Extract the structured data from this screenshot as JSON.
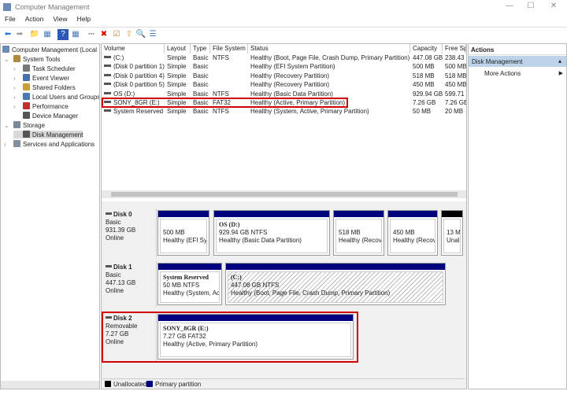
{
  "window": {
    "title": "Computer Management",
    "min": "—",
    "max": "☐",
    "close": "✕"
  },
  "menu": [
    "File",
    "Action",
    "View",
    "Help"
  ],
  "toolbar": {
    "icons": [
      "back-icon",
      "forward-icon",
      "up-folder-icon",
      "show-hide-tree-icon",
      "help-icon",
      "properties-view-icon",
      "connect-icon",
      "delete-icon",
      "check-icon",
      "folder-up-icon",
      "folder-search-icon",
      "list-view-icon"
    ]
  },
  "tree": [
    {
      "label": "Computer Management (Local",
      "indent": 0,
      "tw": "",
      "color": "#6a8bb5"
    },
    {
      "label": "System Tools",
      "indent": 1,
      "tw": "⌄",
      "color": "#b08a3c"
    },
    {
      "label": "Task Scheduler",
      "indent": 2,
      "tw": "›",
      "color": "#777"
    },
    {
      "label": "Event Viewer",
      "indent": 2,
      "tw": "›",
      "color": "#4a6fb0"
    },
    {
      "label": "Shared Folders",
      "indent": 2,
      "tw": "›",
      "color": "#c8a030"
    },
    {
      "label": "Local Users and Groups",
      "indent": 2,
      "tw": "›",
      "color": "#4a7ab5"
    },
    {
      "label": "Performance",
      "indent": 2,
      "tw": "›",
      "color": "#c03030"
    },
    {
      "label": "Device Manager",
      "indent": 2,
      "tw": "",
      "color": "#555"
    },
    {
      "label": "Storage",
      "indent": 1,
      "tw": "⌄",
      "color": "#7a8a9a"
    },
    {
      "label": "Disk Management",
      "indent": 2,
      "tw": "",
      "color": "#555",
      "selected": true
    },
    {
      "label": "Services and Applications",
      "indent": 1,
      "tw": "›",
      "color": "#8090a0"
    }
  ],
  "volume_list": {
    "columns": [
      "Volume",
      "Layout",
      "Type",
      "File System",
      "Status",
      "Capacity",
      "Free Sp"
    ],
    "rows": [
      [
        "(C:)",
        "Simple",
        "Basic",
        "NTFS",
        "Healthy (Boot, Page File, Crash Dump, Primary Partition)",
        "447.08 GB",
        "238.43"
      ],
      [
        "(Disk 0 partition 1)",
        "Simple",
        "Basic",
        "",
        "Healthy (EFI System Partition)",
        "500 MB",
        "500 MB"
      ],
      [
        "(Disk 0 partition 4)",
        "Simple",
        "Basic",
        "",
        "Healthy (Recovery Partition)",
        "518 MB",
        "518 MB"
      ],
      [
        "(Disk 0 partition 5)",
        "Simple",
        "Basic",
        "",
        "Healthy (Recovery Partition)",
        "450 MB",
        "450 MB"
      ],
      [
        "OS (D:)",
        "Simple",
        "Basic",
        "NTFS",
        "Healthy (Basic Data Partition)",
        "929.94 GB",
        "599.71"
      ],
      [
        "SONY_8GR (E:)",
        "Simple",
        "Basic",
        "FAT32",
        "Healthy (Active, Primary Partition)",
        "7.26 GB",
        "7.26 GB"
      ],
      [
        "System Reserved",
        "Simple",
        "Basic",
        "NTFS",
        "Healthy (System, Active, Primary Partition)",
        "50 MB",
        "20 MB"
      ]
    ],
    "highlighted_row": 5
  },
  "disks": [
    {
      "name": "Disk 0",
      "type": "Basic",
      "size": "931.39 GB",
      "status": "Online",
      "partitions": [
        {
          "title": "",
          "size": "500 MB",
          "status": "Healthy (EFI Syst"
        },
        {
          "title": "OS  (D:)",
          "size": "929.94 GB NTFS",
          "status": "Healthy (Basic Data Partition)"
        },
        {
          "title": "",
          "size": "518 MB",
          "status": "Healthy (Recover"
        },
        {
          "title": "",
          "size": "450 MB",
          "status": "Healthy (Recove"
        },
        {
          "title": "",
          "size": "13 MB",
          "status": "Unallocated",
          "unallocated": true
        }
      ]
    },
    {
      "name": "Disk 1",
      "type": "Basic",
      "size": "447.13 GB",
      "status": "Online",
      "partitions": [
        {
          "title": "System Reserved",
          "size": "50 MB NTFS",
          "status": "Healthy (System, Acti"
        },
        {
          "title": "(C:)",
          "size": "447.08 GB NTFS",
          "status": "Healthy (Boot, Page File, Crash Dump, Primary Partition)",
          "selected": true
        }
      ]
    },
    {
      "name": "Disk 2",
      "type": "Removable",
      "size": "7.27 GB",
      "status": "Online",
      "highlighted": true,
      "partitions": [
        {
          "title": "SONY_8GR  (E:)",
          "size": "7.27 GB FAT32",
          "status": "Healthy (Active, Primary Partition)"
        }
      ]
    }
  ],
  "legend": [
    {
      "label": "Unallocated",
      "color": "#000000"
    },
    {
      "label": "Primary partition",
      "color": "#00007f"
    }
  ],
  "actions": {
    "header": "Actions",
    "section": "Disk Management",
    "items": [
      "More Actions"
    ]
  },
  "colors": {
    "primary": "#00007f",
    "highlight": "#d00000",
    "selection": "#cce4f7"
  }
}
